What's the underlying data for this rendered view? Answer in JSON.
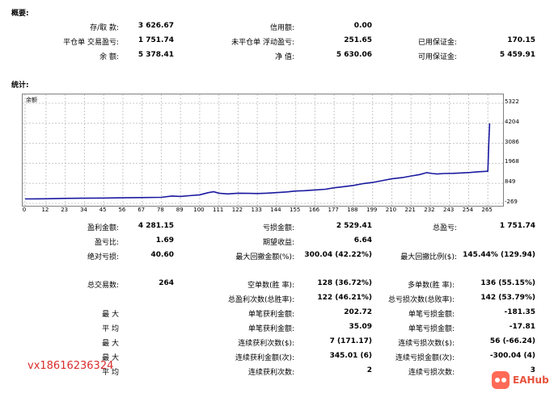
{
  "sections": {
    "summary": "概要:",
    "stats": "统计:"
  },
  "summary": {
    "rows": [
      [
        {
          "label": "存/取 款:",
          "value": "3 626.67"
        },
        {
          "label": "信用额:",
          "value": "0.00"
        },
        {
          "label": "",
          "value": ""
        }
      ],
      [
        {
          "label": "平仓单 交易盈亏:",
          "value": "1 751.74"
        },
        {
          "label": "未平仓单 浮动盈亏:",
          "value": "251.65"
        },
        {
          "label": "已用保证金:",
          "value": "170.15"
        }
      ],
      [
        {
          "label": "余 额:",
          "value": "5 378.41"
        },
        {
          "label": "净 值:",
          "value": "5 630.06"
        },
        {
          "label": "可用保证金:",
          "value": "5 459.91"
        }
      ]
    ]
  },
  "chart_data": {
    "type": "line",
    "legend": "余额",
    "line_color": "#1a1aa0",
    "xlim": [
      0,
      270
    ],
    "ylim": [
      -269,
      5322
    ],
    "x_ticks": [
      0,
      12,
      23,
      34,
      45,
      56,
      67,
      78,
      89,
      100,
      111,
      122,
      133,
      144,
      155,
      166,
      177,
      188,
      199,
      210,
      221,
      232,
      243,
      254,
      265
    ],
    "y_ticks": [
      5322,
      4204,
      3086,
      1968,
      849,
      -269
    ],
    "series": [
      {
        "x": [
          0,
          6,
          12,
          18,
          23,
          34,
          45,
          56,
          67,
          78,
          84,
          89,
          94,
          100,
          105,
          108,
          111,
          116,
          122,
          128,
          133,
          138,
          144,
          150,
          155,
          160,
          166,
          172,
          177,
          182,
          188,
          194,
          199,
          205,
          210,
          216,
          221,
          226,
          230,
          233,
          236,
          240,
          245,
          250,
          255,
          260,
          264,
          265,
          265.5,
          266
        ],
        "y": [
          -20,
          -15,
          -10,
          -5,
          10,
          20,
          30,
          40,
          55,
          70,
          140,
          120,
          160,
          210,
          330,
          380,
          300,
          260,
          300,
          290,
          280,
          300,
          330,
          370,
          420,
          440,
          480,
          520,
          600,
          660,
          730,
          840,
          900,
          1010,
          1100,
          1170,
          1260,
          1340,
          1450,
          1400,
          1370,
          1400,
          1410,
          1430,
          1460,
          1500,
          1520,
          1530,
          3000,
          4200
        ]
      }
    ]
  },
  "stats": {
    "block1": [
      [
        {
          "label": "盈利金额:",
          "value": "4 281.15"
        },
        {
          "label": "亏损金额:",
          "value": "2 529.41"
        },
        {
          "label": "总盈亏:",
          "value": "1 751.74"
        }
      ],
      [
        {
          "label": "盈亏比:",
          "value": "1.69"
        },
        {
          "label": "期望收益:",
          "value": "6.64"
        },
        {
          "label": "",
          "value": ""
        }
      ],
      [
        {
          "label": "绝对亏损:",
          "value": "40.60"
        },
        {
          "label": "最大回撤金额(%):",
          "value": "300.04 (42.22%)"
        },
        {
          "label": "最大回撤比例($):",
          "value": "145.44% (129.94)"
        }
      ]
    ],
    "block2": [
      [
        {
          "label": "总交易数:",
          "value": "264"
        },
        {
          "label": "空单数(胜 率):",
          "value": "128 (36.72%)"
        },
        {
          "label": "多单数(胜 率):",
          "value": "136 (55.15%)"
        }
      ],
      [
        {
          "label": "",
          "value": ""
        },
        {
          "label": "总盈利次数(总胜率):",
          "value": "122 (46.21%)"
        },
        {
          "label": "总亏损次数(总败率):",
          "value": "142 (53.79%)"
        }
      ],
      [
        {
          "label": "最 大",
          "value": ""
        },
        {
          "label": "单笔获利金额:",
          "value": "202.72"
        },
        {
          "label": "单笔亏损金额:",
          "value": "-181.35"
        }
      ],
      [
        {
          "label": "平 均",
          "value": ""
        },
        {
          "label": "单笔获利金额:",
          "value": "35.09"
        },
        {
          "label": "单笔亏损金额:",
          "value": "-17.81"
        }
      ],
      [
        {
          "label": "最 大",
          "value": ""
        },
        {
          "label": "连续获利次数($):",
          "value": "7 (171.17)"
        },
        {
          "label": "连续亏损次数($):",
          "value": "56 (-66.24)"
        }
      ],
      [
        {
          "label": "最 大",
          "value": ""
        },
        {
          "label": "连续获利金额(次):",
          "value": "345.01 (6)"
        },
        {
          "label": "连续亏损金额(次):",
          "value": "-300.04 (4)"
        }
      ],
      [
        {
          "label": "平 均",
          "value": ""
        },
        {
          "label": "连续获利次数:",
          "value": "2"
        },
        {
          "label": "连续亏损次数:",
          "value": "3"
        }
      ]
    ]
  },
  "watermark": {
    "phone": "vx18616236324",
    "brand": "EAHub"
  }
}
